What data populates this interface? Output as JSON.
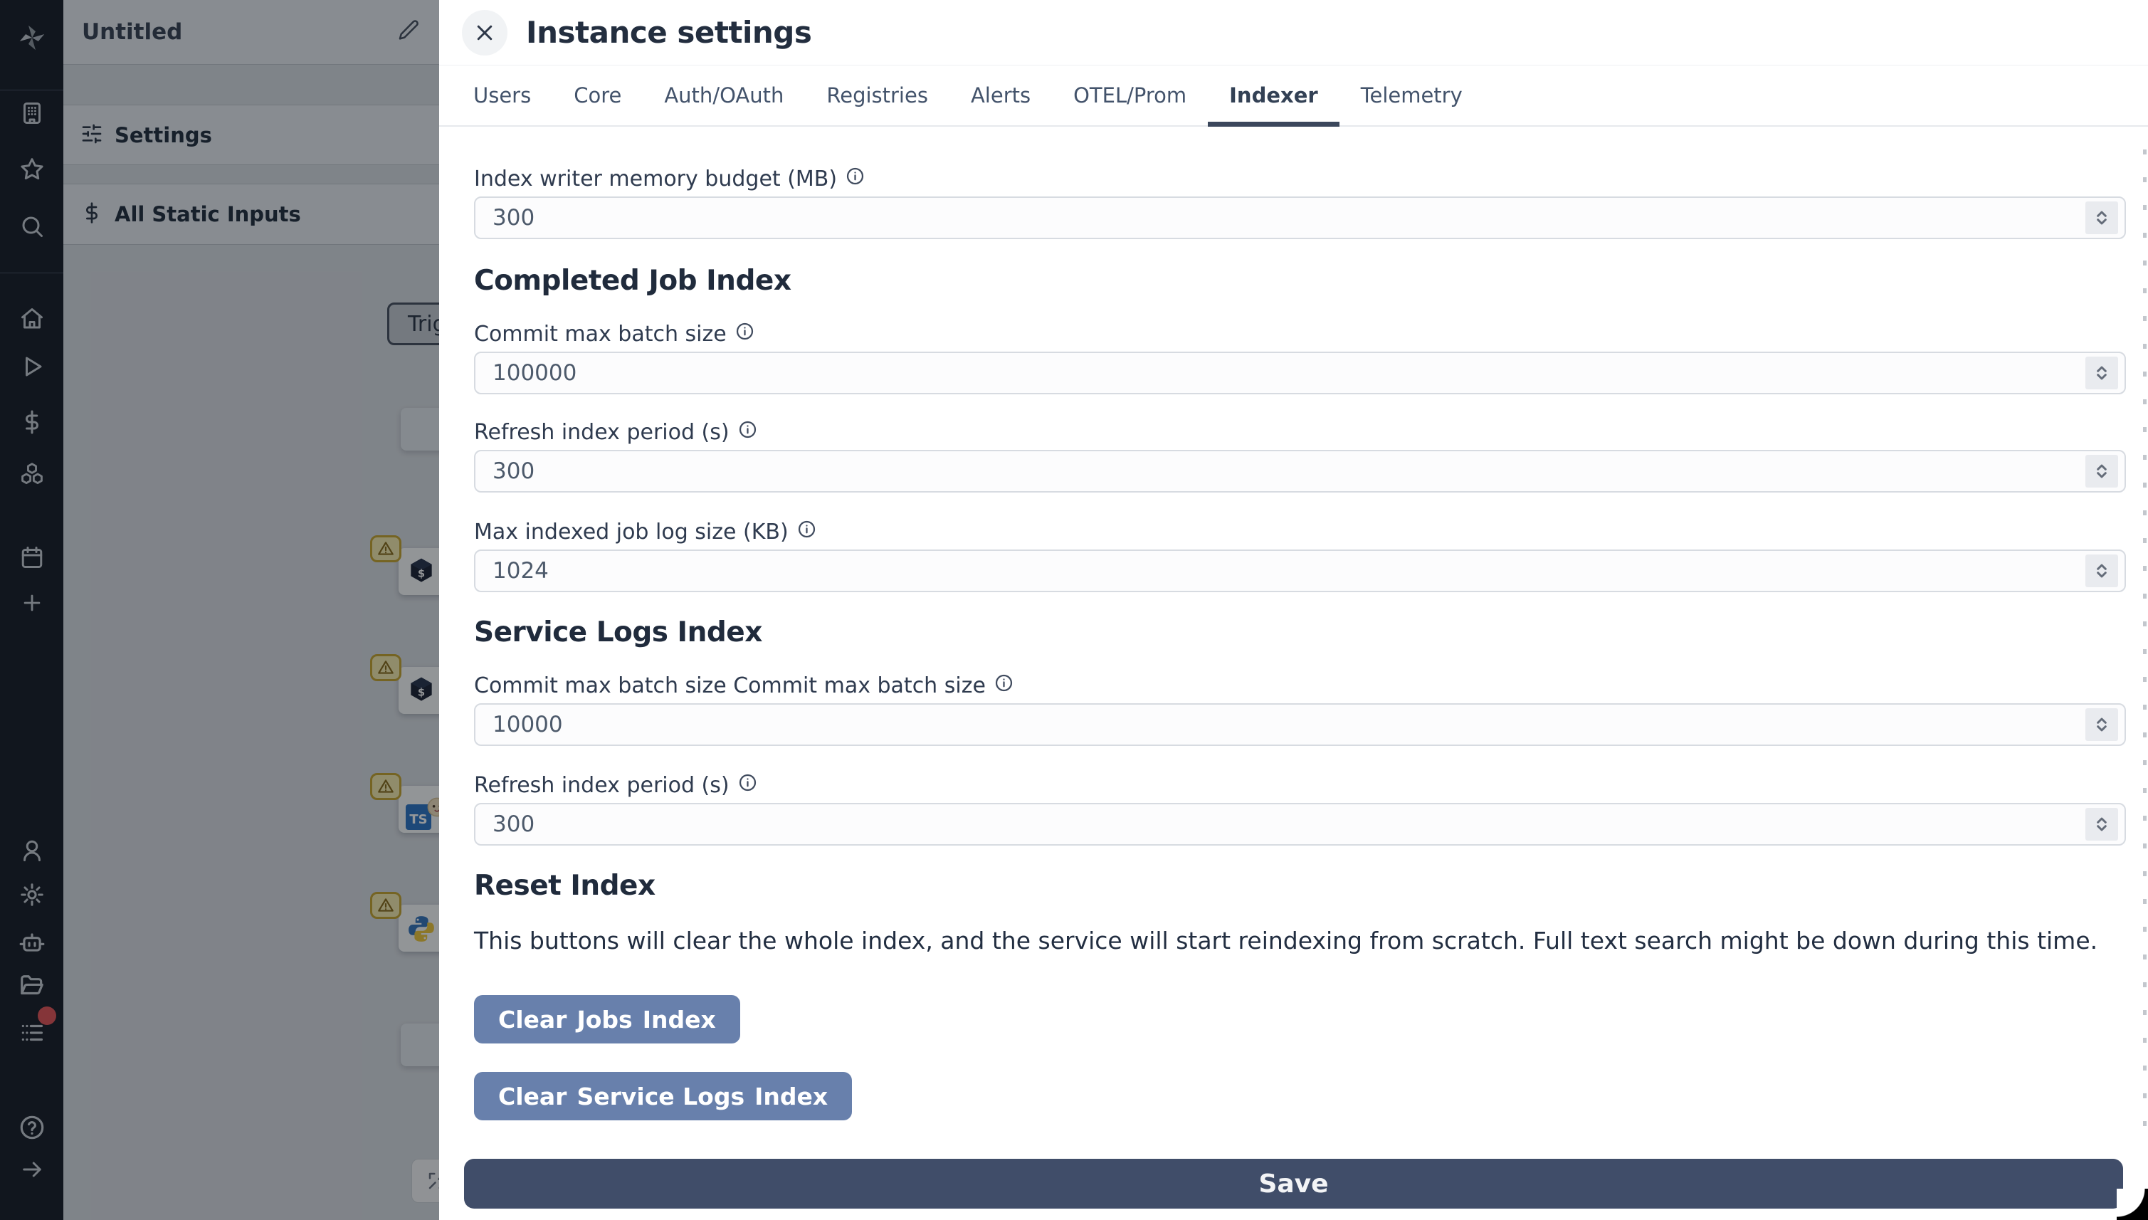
{
  "colors": {
    "save_button": "#404d69",
    "clear_button": "#6880ac",
    "active_tab_underline": "#3b475c",
    "warning_badge_bg": "#f7edb0",
    "warning_badge_border": "#c9a835",
    "notification_dot": "#e4565a",
    "typescript_blue": "#3178c6",
    "python_blue": "#3a77bc",
    "python_yellow": "#efc93f"
  },
  "sidebar": {
    "icons": [
      "windmill-logo",
      "building",
      "star",
      "search",
      "home",
      "play",
      "dollar-sign",
      "boxes",
      "calendar",
      "plus",
      "user",
      "gear",
      "bot",
      "folder-open",
      "list",
      "help-circle",
      "arrow-right"
    ]
  },
  "flow_panel": {
    "title": "Untitled",
    "menu": [
      {
        "label": "Settings"
      },
      {
        "label": "All Static Inputs"
      }
    ],
    "trigger_node": {
      "label": "Trigg"
    },
    "nodes": [
      {
        "icon": "bash-script"
      },
      {
        "icon": "bash-script"
      },
      {
        "icon": "typescript-bun"
      },
      {
        "icon": "python"
      }
    ]
  },
  "modal": {
    "title": "Instance settings",
    "active_tab": "Indexer",
    "tabs": [
      {
        "label": "Users"
      },
      {
        "label": "Core"
      },
      {
        "label": "Auth/OAuth"
      },
      {
        "label": "Registries"
      },
      {
        "label": "Alerts"
      },
      {
        "label": "OTEL/Prom"
      },
      {
        "label": "Indexer"
      },
      {
        "label": "Telemetry"
      }
    ],
    "fields": [
      {
        "label": "Index writer memory budget (MB)",
        "value": "300"
      },
      {
        "label": "Commit max batch size",
        "value": "100000"
      },
      {
        "label": "Refresh index period (s)",
        "value": "300"
      },
      {
        "label": "Max indexed job log size (KB)",
        "value": "1024"
      },
      {
        "label": "Commit max batch size Commit max batch size",
        "value": "10000"
      },
      {
        "label": "Refresh index period (s)",
        "value": "300"
      }
    ],
    "sections": {
      "completed_job_index": "Completed Job Index",
      "service_logs_index": "Service Logs Index",
      "reset_index": "Reset Index"
    },
    "reset_note": "This buttons will clear the whole index, and the service will start reindexing from scratch. Full text search might be down during this time.",
    "buttons": {
      "clear_jobs": {
        "pre": "Clear",
        "emph": "Jobs",
        "post": "Index"
      },
      "clear_service_logs": {
        "pre": "Clear",
        "emph": "Service Logs",
        "post": "Index"
      },
      "save": "Save"
    }
  }
}
